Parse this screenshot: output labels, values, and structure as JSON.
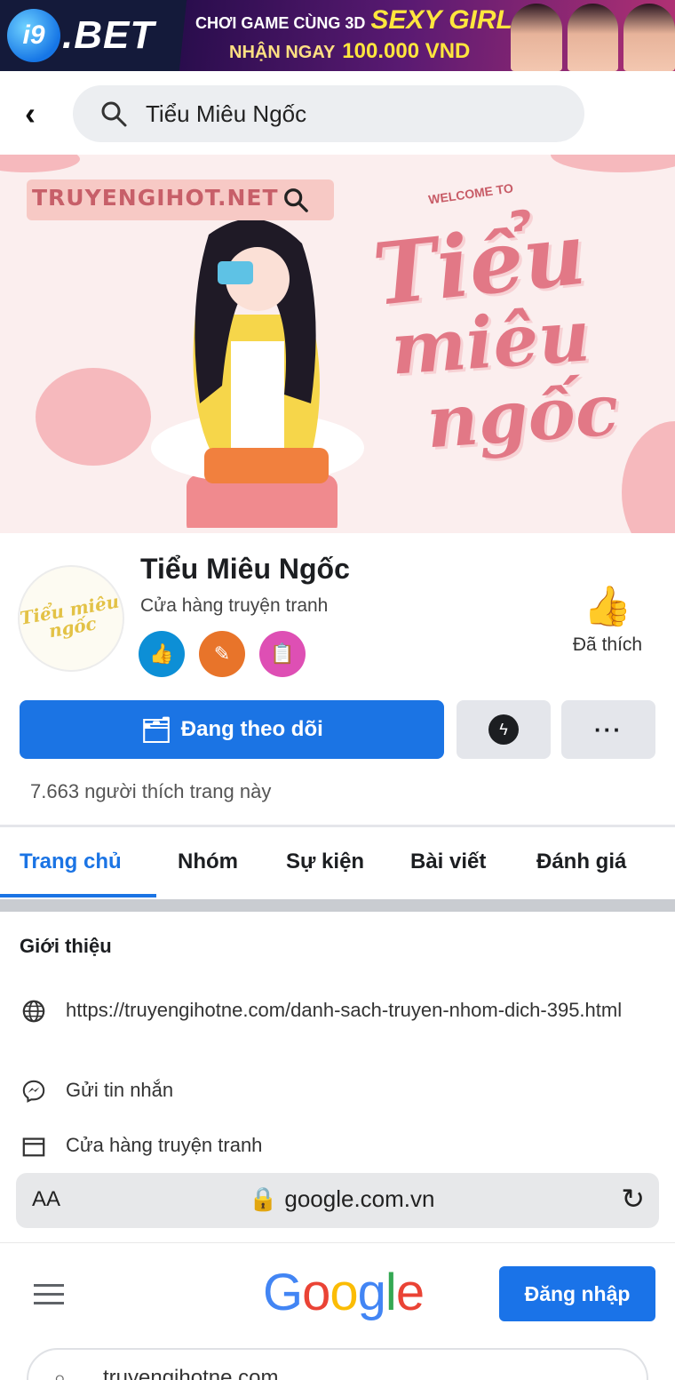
{
  "ad": {
    "logo_badge": "i9",
    "logo_text": ".BET",
    "line1_small": "CHƠI GAME CÙNG 3D",
    "line1_big": "SEXY GIRL",
    "line2_small": "NHẬN NGAY",
    "line2_big": "100.000 VND"
  },
  "topbar": {
    "back_icon": "chevron-left-icon",
    "search_query": "Tiểu Miêu Ngốc"
  },
  "cover": {
    "brand": "TRUYENGIHOT.NET",
    "welcome": "WELCOME TO",
    "title_line1": "Tiểu",
    "title_line2": "miêu",
    "title_line3": "ngốc"
  },
  "profile": {
    "avatar_text": "Tiểu miêu ngốc",
    "name": "Tiểu Miêu Ngốc",
    "category": "Cửa hàng truyện tranh",
    "liked_label": "Đã thích",
    "follow_label": "Đang theo dõi",
    "more_label": "···",
    "likes_count": "7.663 người thích trang này"
  },
  "tabs": [
    {
      "label": "Trang chủ",
      "active": true
    },
    {
      "label": "Nhóm",
      "active": false
    },
    {
      "label": "Sự kiện",
      "active": false
    },
    {
      "label": "Bài viết",
      "active": false
    },
    {
      "label": "Đánh giá",
      "active": false
    }
  ],
  "intro": {
    "title": "Giới thiệu",
    "website": "https://truyengihotne.com/danh-sach-truyen-nhom-dich-395.html",
    "message": "Gửi tin nhắn",
    "category": "Cửa hàng truyện tranh"
  },
  "browser": {
    "aa_label": "AA",
    "url": "google.com.vn"
  },
  "google": {
    "logo": "Google",
    "signin_label": "Đăng nhập",
    "search_value": "truyengihotne.com"
  },
  "colors": {
    "facebook_blue": "#1b74e4",
    "google_blue": "#1a73e8",
    "cover_pink": "#e27886"
  }
}
